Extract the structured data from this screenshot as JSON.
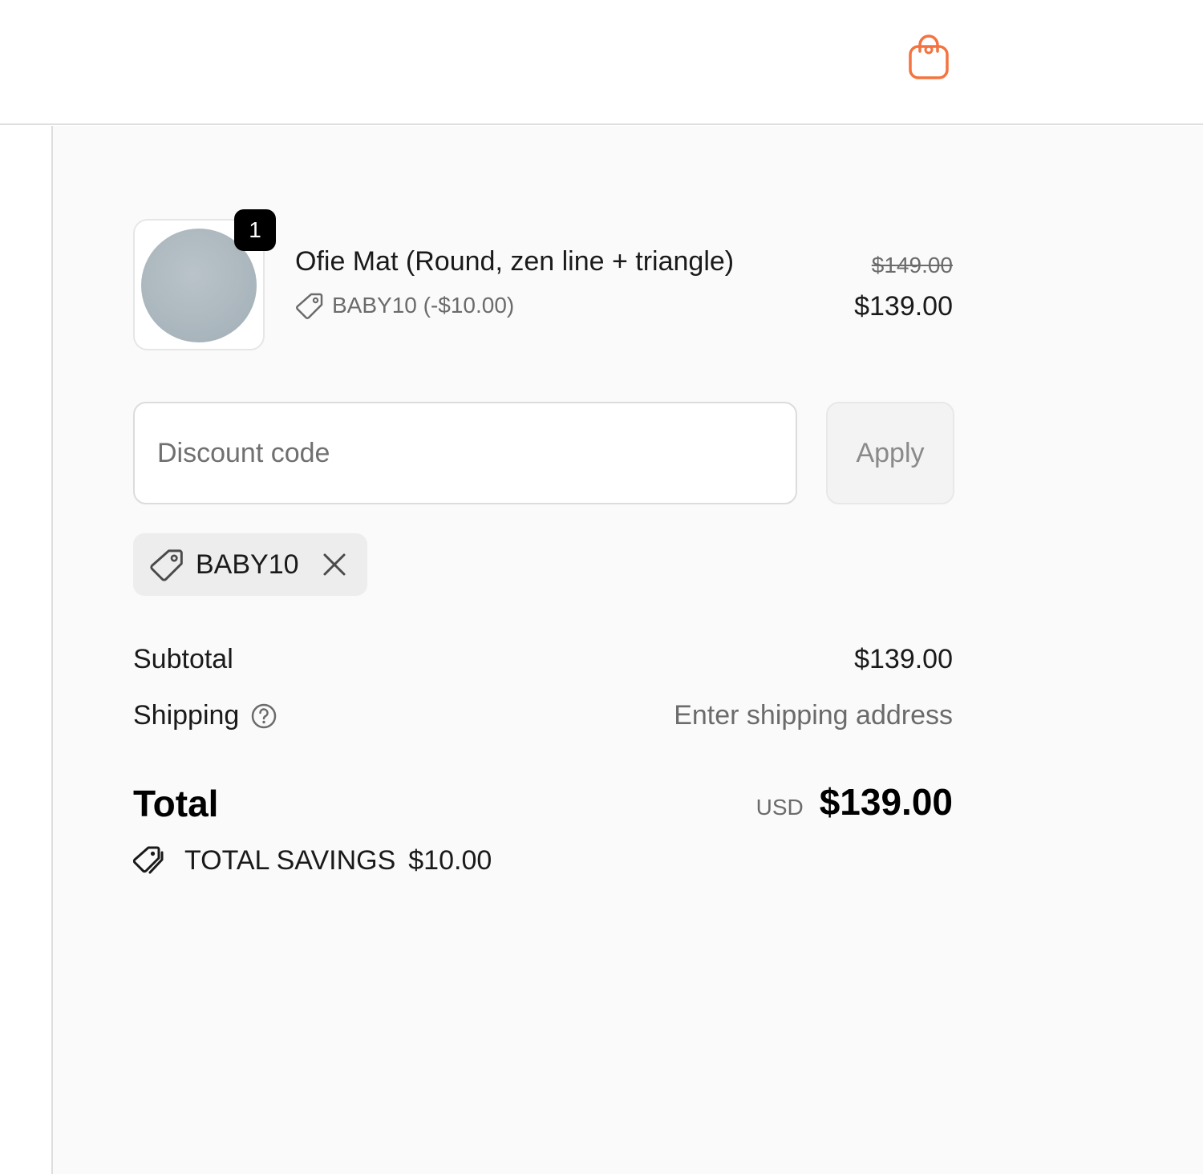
{
  "header": {
    "cart_icon": "shopping-bag-icon",
    "accent_color": "#f4733e"
  },
  "line_item": {
    "quantity": "1",
    "title": "Ofie Mat (Round, zen line + triangle)",
    "discount_tag": "BABY10 (-$10.00)",
    "original_price": "$149.00",
    "price": "$139.00"
  },
  "discount": {
    "placeholder": "Discount code",
    "value": "",
    "apply_label": "Apply",
    "applied_code": "BABY10"
  },
  "summary": {
    "subtotal_label": "Subtotal",
    "subtotal_value": "$139.00",
    "shipping_label": "Shipping",
    "shipping_value": "Enter shipping address",
    "total_label": "Total",
    "total_currency": "USD",
    "total_value": "$139.00",
    "savings_label": "TOTAL SAVINGS",
    "savings_value": "$10.00"
  }
}
